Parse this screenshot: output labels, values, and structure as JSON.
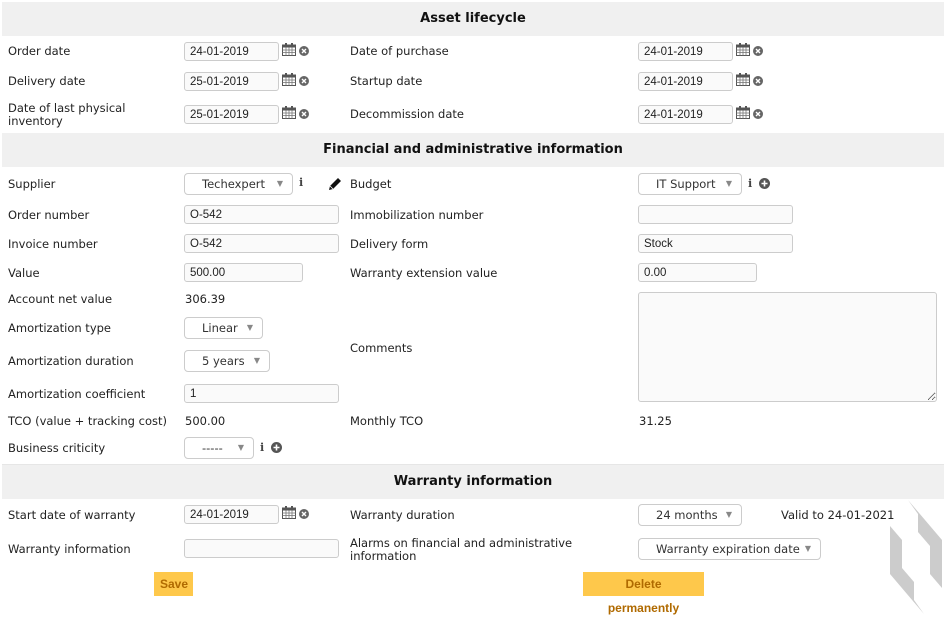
{
  "sections": {
    "lifecycle": "Asset lifecycle",
    "financial": "Financial and administrative information",
    "warranty": "Warranty information"
  },
  "lifecycle": {
    "order_date": {
      "label": "Order date",
      "value": "24-01-2019"
    },
    "delivery_date": {
      "label": "Delivery date",
      "value": "25-01-2019"
    },
    "last_inventory": {
      "label": "Date of last physical inventory",
      "value": "25-01-2019"
    },
    "purchase_date": {
      "label": "Date of purchase",
      "value": "24-01-2019"
    },
    "startup_date": {
      "label": "Startup date",
      "value": "24-01-2019"
    },
    "decommission_date": {
      "label": "Decommission date",
      "value": "24-01-2019"
    }
  },
  "financial": {
    "supplier": {
      "label": "Supplier",
      "value": "Techexpert"
    },
    "order_number": {
      "label": "Order number",
      "value": "O-542"
    },
    "invoice_number": {
      "label": "Invoice number",
      "value": "O-542"
    },
    "value": {
      "label": "Value",
      "value": "500.00"
    },
    "account_net_value": {
      "label": "Account net value",
      "value": "306.39"
    },
    "amortization_type": {
      "label": "Amortization type",
      "value": "Linear"
    },
    "amortization_duration": {
      "label": "Amortization duration",
      "value": "5 years"
    },
    "amortization_coefficient": {
      "label": "Amortization coefficient",
      "value": "1"
    },
    "tco": {
      "label": "TCO (value + tracking cost)",
      "value": "500.00"
    },
    "business_criticity": {
      "label": "Business criticity",
      "value": "-----"
    },
    "budget": {
      "label": "Budget",
      "value": "IT Support"
    },
    "immobilization_number": {
      "label": "Immobilization number",
      "value": ""
    },
    "delivery_form": {
      "label": "Delivery form",
      "value": "Stock"
    },
    "warranty_extension_value": {
      "label": "Warranty extension value",
      "value": "0.00"
    },
    "comments": {
      "label": "Comments",
      "value": ""
    },
    "monthly_tco": {
      "label": "Monthly TCO",
      "value": "31.25"
    }
  },
  "warranty": {
    "start_date": {
      "label": "Start date of warranty",
      "value": "24-01-2019"
    },
    "information": {
      "label": "Warranty information",
      "value": ""
    },
    "duration": {
      "label": "Warranty duration",
      "value": "24 months"
    },
    "valid_to": "Valid to 24-01-2021",
    "alarms": {
      "label": "Alarms on financial and administrative information",
      "value": "Warranty expiration date"
    }
  },
  "buttons": {
    "save": "Save",
    "delete": "Delete permanently"
  },
  "icons": {
    "dropdown_arrow": "▼",
    "info": "i"
  },
  "colors": {
    "button_bg": "#fec84b",
    "button_text": "#b06a00",
    "section_bg": "#f0f0f0"
  }
}
